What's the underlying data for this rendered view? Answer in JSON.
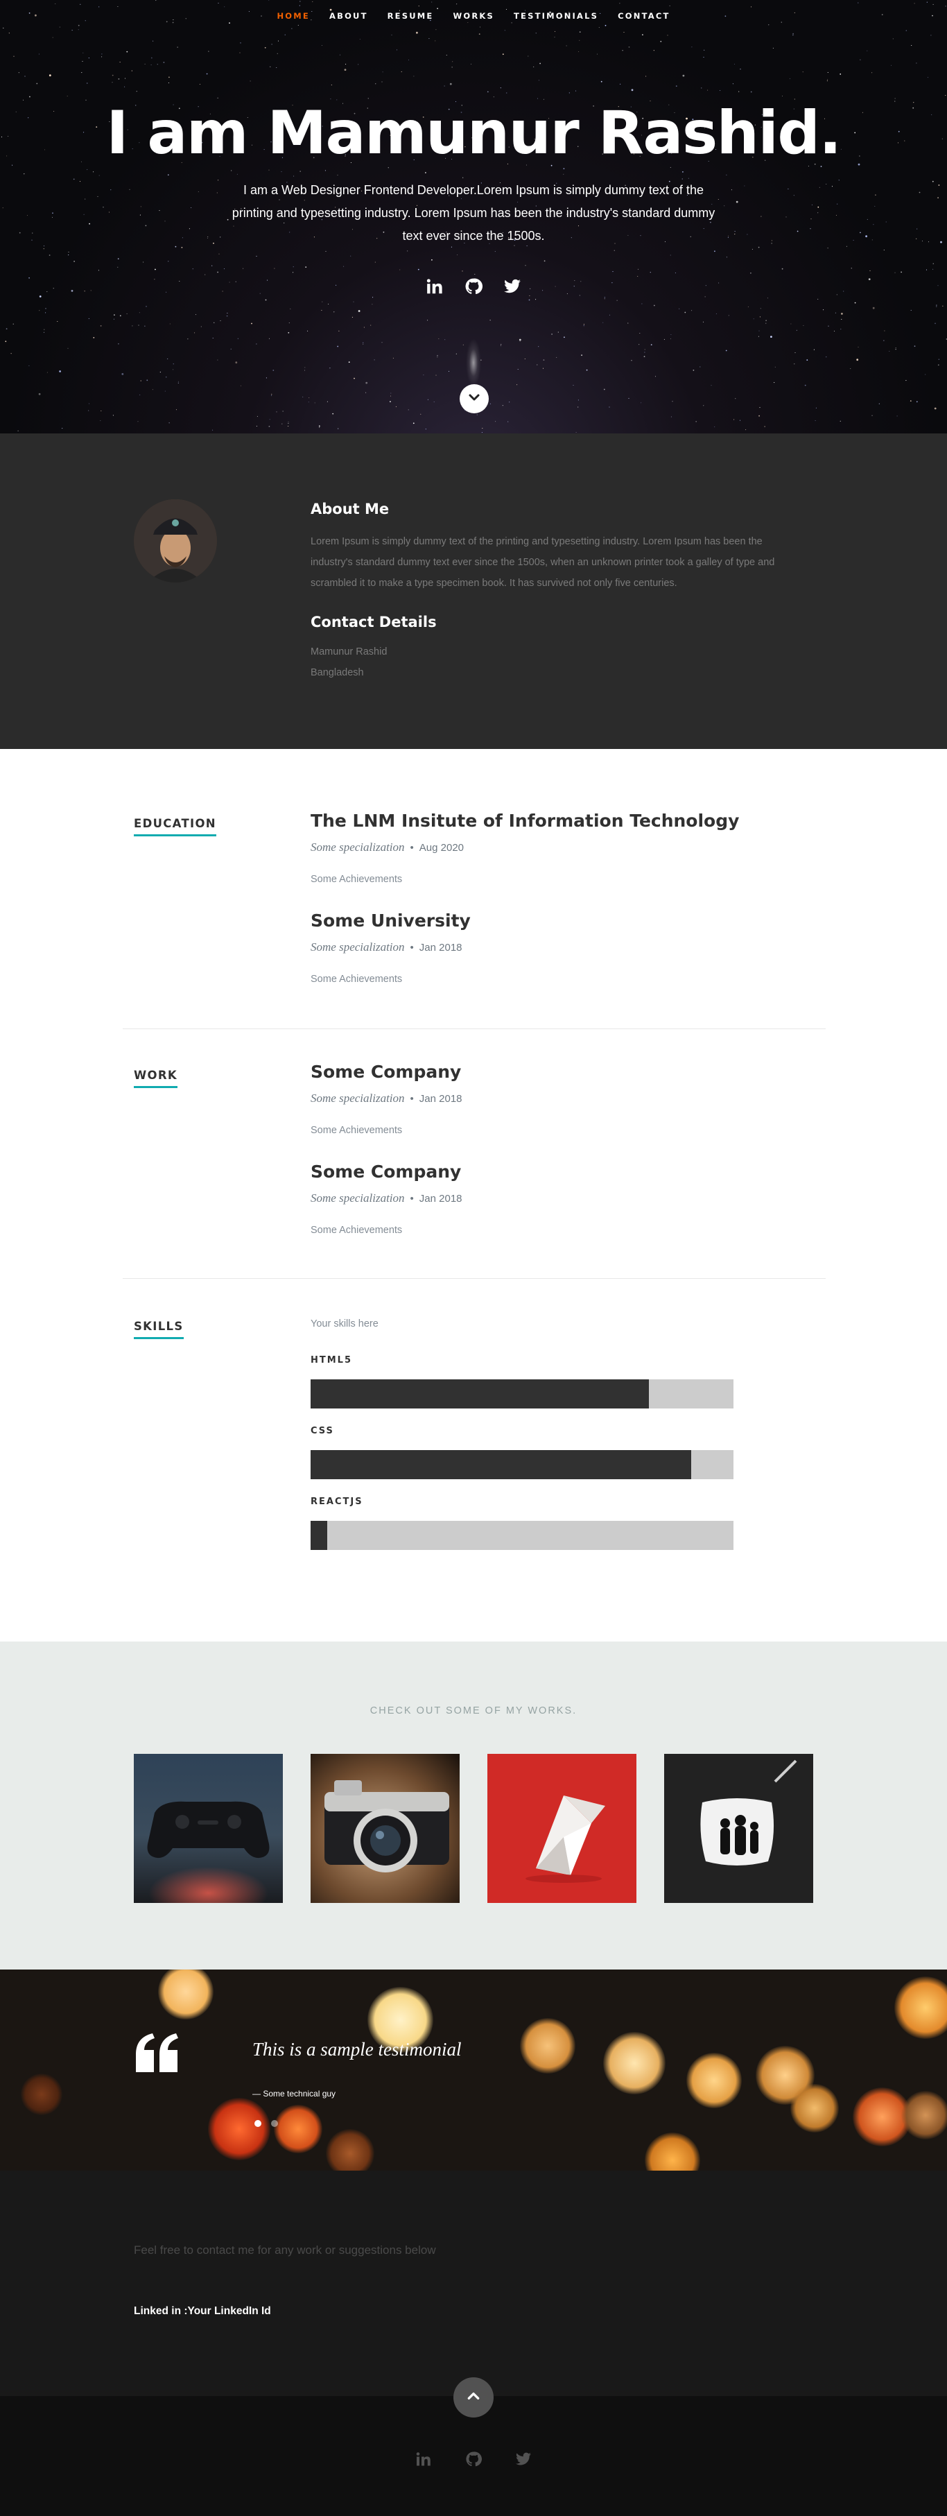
{
  "nav": {
    "items": [
      {
        "label": "HOME",
        "current": true
      },
      {
        "label": "ABOUT",
        "current": false
      },
      {
        "label": "RESUME",
        "current": false
      },
      {
        "label": "WORKS",
        "current": false
      },
      {
        "label": "TESTIMONIALS",
        "current": false
      },
      {
        "label": "CONTACT",
        "current": false
      }
    ],
    "current_color": "#f06000"
  },
  "hero": {
    "headline": "I am Mamunur Rashid.",
    "intro": "I am a Web Designer Frontend Developer.Lorem Ipsum is simply dummy text of the printing and typesetting industry. Lorem Ipsum has been the industry's standard dummy text ever since the 1500s.",
    "social_icons": [
      "linkedin-icon",
      "github-icon",
      "twitter-icon"
    ],
    "scroll_icon": "chevron-down-icon"
  },
  "about": {
    "heading": "About Me",
    "bio": "Lorem Ipsum is simply dummy text of the printing and typesetting industry. Lorem Ipsum has been the industry's standard dummy text ever since the 1500s, when an unknown printer took a galley of type and scrambled it to make a type specimen book. It has survived not only five centuries.",
    "contact_heading": "Contact Details",
    "contact_name": "Mamunur Rashid",
    "contact_country": "Bangladesh"
  },
  "resume": {
    "accent_color": "#11abb0",
    "education": {
      "label": "EDUCATION",
      "entries": [
        {
          "title": "The LNM Insitute of Information Technology",
          "specialization": "Some specialization",
          "date": "Aug 2020",
          "achievements": "Some Achievements"
        },
        {
          "title": "Some University",
          "specialization": "Some specialization",
          "date": "Jan 2018",
          "achievements": "Some Achievements"
        }
      ]
    },
    "work": {
      "label": "WORK",
      "entries": [
        {
          "title": "Some Company",
          "specialization": "Some specialization",
          "date": "Jan 2018",
          "achievements": "Some Achievements"
        },
        {
          "title": "Some Company",
          "specialization": "Some specialization",
          "date": "Jan 2018",
          "achievements": "Some Achievements"
        }
      ]
    },
    "skills": {
      "label": "SKILLS",
      "note": "Your skills here",
      "items": [
        {
          "name": "HTML5",
          "level": 0.8
        },
        {
          "name": "CSS",
          "level": 0.9
        },
        {
          "name": "REACTJS",
          "level": 0.04
        }
      ]
    }
  },
  "portfolio": {
    "heading": "CHECK OUT SOME OF MY WORKS.",
    "items": [
      "game-controller-photo",
      "camera-photo",
      "origami-bird-photo",
      "silhouette-people-photo"
    ]
  },
  "testimonials": {
    "quote_icon": "quote-icon",
    "text": "This is a sample testimonial",
    "cite": "— Some technical guy",
    "active_slide": 0,
    "slide_count": 2
  },
  "contact": {
    "lead": "Feel free to contact me for any work or suggestions below",
    "linkedin": "Linked in :Your LinkedIn Id"
  },
  "footer": {
    "go_top_icon": "chevron-up-icon",
    "social_icons": [
      "linkedin-icon",
      "github-icon",
      "twitter-icon"
    ]
  }
}
